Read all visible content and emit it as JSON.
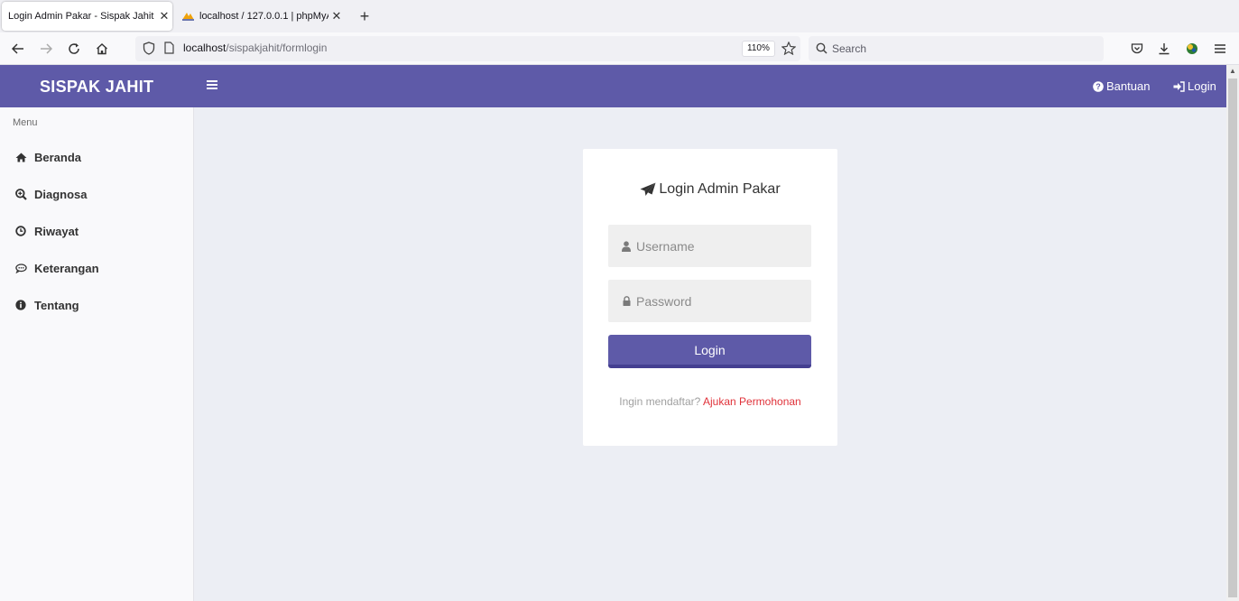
{
  "browser": {
    "tabs": [
      {
        "title": "Login Admin Pakar - Sispak Jahit",
        "active": true
      },
      {
        "title": "localhost / 127.0.0.1 | phpMyAd",
        "active": false
      }
    ],
    "url_host": "localhost",
    "url_path": "/sispakjahit/formlogin",
    "zoom": "110%",
    "search_placeholder": "Search"
  },
  "header": {
    "brand": "SISPAK JAHIT",
    "help_label": "Bantuan",
    "login_label": "Login",
    "color": "#5e5aa8"
  },
  "sidebar": {
    "caption": "Menu",
    "items": [
      {
        "label": "Beranda",
        "icon": "home-icon"
      },
      {
        "label": "Diagnosa",
        "icon": "search-plus-icon"
      },
      {
        "label": "Riwayat",
        "icon": "clock-icon"
      },
      {
        "label": "Keterangan",
        "icon": "comment-icon"
      },
      {
        "label": "Tentang",
        "icon": "info-icon"
      }
    ]
  },
  "login": {
    "title": "Login Admin Pakar",
    "username_placeholder": "Username",
    "password_placeholder": "Password",
    "button_label": "Login",
    "register_prompt": "Ingin mendaftar?",
    "register_link": "Ajukan Permohonan"
  }
}
